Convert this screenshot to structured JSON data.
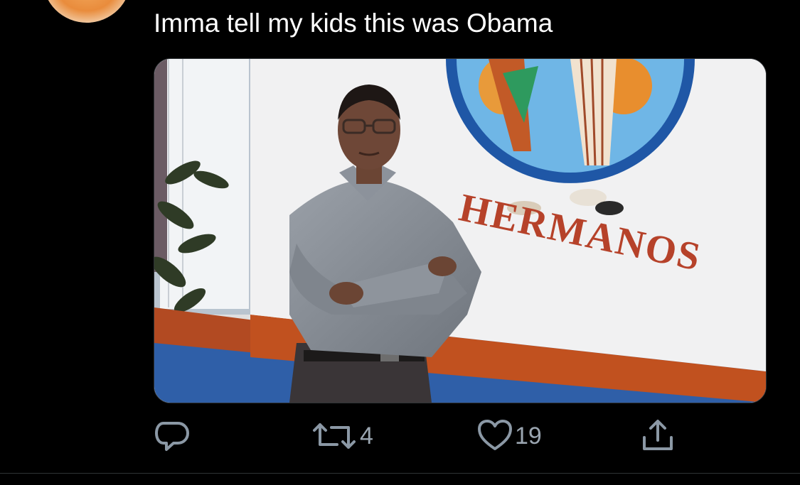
{
  "tweet": {
    "text": "Imma tell my kids this was Obama",
    "avatar_icon": "avatar-photo",
    "media": {
      "wall_sign_text": "HERMANOS"
    }
  },
  "actions": {
    "reply": {
      "icon": "reply-bubble-icon",
      "count": ""
    },
    "retweet": {
      "icon": "retweet-icon",
      "count": "4"
    },
    "like": {
      "icon": "heart-icon",
      "count": "19"
    },
    "share": {
      "icon": "share-icon"
    }
  },
  "colors": {
    "background": "#000000",
    "text": "#ffffff",
    "icon": "#8b98a5",
    "divider": "#2f3336"
  }
}
